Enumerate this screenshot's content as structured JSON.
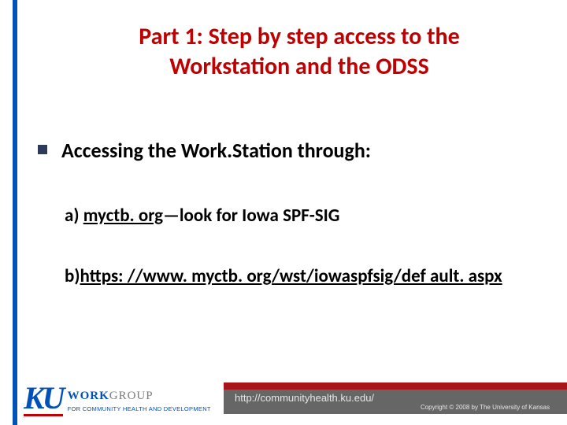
{
  "title": "Part 1: Step by step access to the Workstation and the ODSS",
  "bullet": "Accessing the Work.Station through:",
  "item_a": {
    "prefix": "a) ",
    "link": "myctb. org",
    "suffix": "—look for Iowa SPF-SIG"
  },
  "item_b": {
    "prefix": "b)",
    "link": "https: //www. myctb. org/wst/iowaspfsig/def ault. aspx"
  },
  "logo": {
    "mark": "KU",
    "work": "WORK",
    "group": "GROUP",
    "tagline": "FOR COMMUNITY HEALTH AND DEVELOPMENT"
  },
  "footer": {
    "url": "http://communityhealth.ku.edu/",
    "copyright": "Copyright © 2008 by The University of Kansas"
  }
}
